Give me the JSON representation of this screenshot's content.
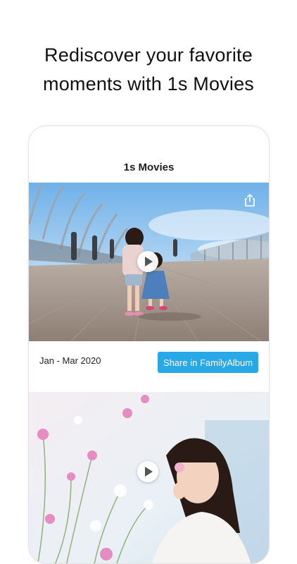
{
  "headline": {
    "line1": "Rediscover your favorite",
    "line2": "moments with 1s Movies"
  },
  "screen": {
    "nav_title": "1s Movies",
    "movies": [
      {
        "date_range": "Jan - Mar 2020",
        "share_button_label": "Share in FamilyAlbum",
        "icons": [
          "share-icon",
          "play-icon"
        ]
      },
      {
        "icons": [
          "play-icon"
        ]
      }
    ]
  },
  "colors": {
    "accent": "#29a8e8",
    "text": "#111111"
  }
}
